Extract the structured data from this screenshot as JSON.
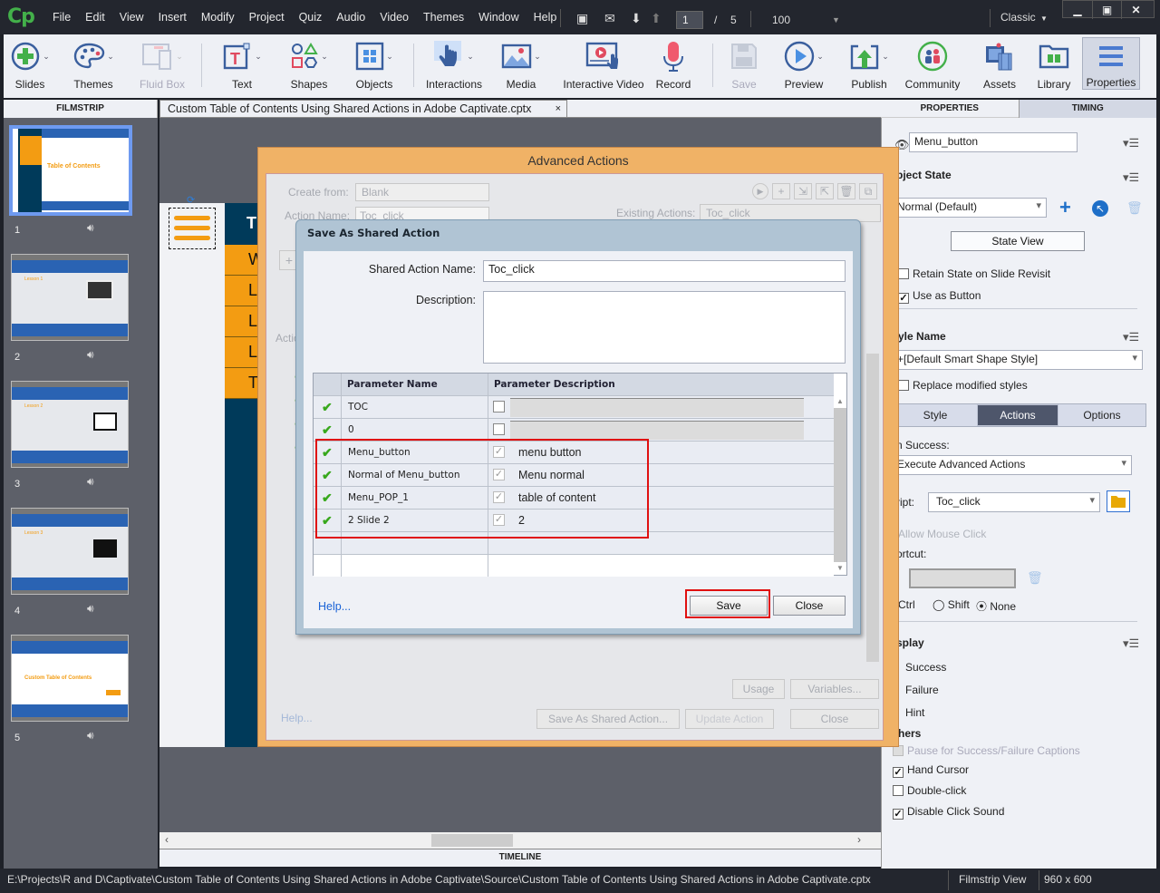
{
  "app": {
    "logo": "Cp",
    "menu": [
      "File",
      "Edit",
      "View",
      "Insert",
      "Modify",
      "Project",
      "Quiz",
      "Audio",
      "Video",
      "Themes",
      "Window",
      "Help"
    ],
    "page_current": "1",
    "page_sep": "/",
    "page_total": "5",
    "zoom": "100",
    "workspace": "Classic",
    "window_controls": [
      "minimize",
      "maximize",
      "close"
    ]
  },
  "toolbar": {
    "items": [
      {
        "label": "Slides",
        "icon": "plus-circle-icon"
      },
      {
        "label": "Themes",
        "icon": "palette-icon"
      },
      {
        "label": "Fluid Box",
        "icon": "fluid-box-icon",
        "disabled": true
      },
      {
        "label": "Text",
        "icon": "text-icon"
      },
      {
        "label": "Shapes",
        "icon": "shapes-icon"
      },
      {
        "label": "Objects",
        "icon": "objects-icon"
      },
      {
        "label": "Interactions",
        "icon": "hand-pointer-icon"
      },
      {
        "label": "Media",
        "icon": "image-icon"
      },
      {
        "label": "Interactive Video",
        "icon": "interactive-video-icon"
      },
      {
        "label": "Record",
        "icon": "microphone-icon"
      },
      {
        "label": "Save",
        "icon": "floppy-icon",
        "disabled": true
      },
      {
        "label": "Preview",
        "icon": "play-icon"
      },
      {
        "label": "Publish",
        "icon": "publish-icon"
      },
      {
        "label": "Community",
        "icon": "community-icon"
      },
      {
        "label": "Assets",
        "icon": "assets-icon"
      },
      {
        "label": "Library",
        "icon": "library-icon"
      },
      {
        "label": "Properties",
        "icon": "properties-icon"
      }
    ]
  },
  "filmstrip": {
    "header": "FILMSTRIP",
    "slides": [
      {
        "num": "1",
        "title": "Table of Contents"
      },
      {
        "num": "2",
        "title": "Lesson 1"
      },
      {
        "num": "3",
        "title": "Lesson 2"
      },
      {
        "num": "4",
        "title": "Lesson 3"
      },
      {
        "num": "5",
        "title": "Custom Table of Contents"
      }
    ]
  },
  "document_tab": {
    "title": "Custom Table of Contents Using Shared Actions in Adobe Captivate.cptx",
    "close": "×"
  },
  "slide_canvas": {
    "title_initial": "T",
    "rows": [
      "W",
      "L",
      "L",
      "L",
      "T"
    ]
  },
  "timeline_label": "TIMELINE",
  "status_bar": {
    "path": "E:\\Projects\\R and D\\Captivate\\Custom Table of Contents Using Shared Actions in Adobe Captivate\\Source\\Custom Table of Contents Using Shared Actions in Adobe Captivate.cptx",
    "view": "Filmstrip View",
    "resolution": "960 x 600"
  },
  "properties": {
    "tabs": [
      "PROPERTIES",
      "TIMING"
    ],
    "object_name": "Menu_button",
    "object_state_label": "bject State",
    "state_value": "Normal (Default)",
    "state_view_button": "State View",
    "retain_state": "Retain State on Slide Revisit",
    "use_as_button": "Use as Button",
    "style_name_label": "yle Name",
    "style_value": "+[Default Smart Shape Style]",
    "replace_styles": "Replace modified styles",
    "subtabs": [
      "Style",
      "Actions",
      "Options"
    ],
    "on_success_label": "n Success:",
    "on_success_value": "Execute Advanced Actions",
    "script_label": "ript:",
    "script_value": "Toc_click",
    "allow_mouse_click": "Allow Mouse Click",
    "shortcut_label": "ortcut:",
    "modifiers": [
      "Ctrl",
      "Shift",
      "None"
    ],
    "modifier_selected": "None",
    "display_label": "splay",
    "display_items": [
      "Success",
      "Failure",
      "Hint"
    ],
    "others_label": "thers",
    "others_items": [
      {
        "label": "Pause for Success/Failure Captions",
        "checked": false,
        "disabled": true
      },
      {
        "label": "Hand Cursor",
        "checked": true
      },
      {
        "label": "Double-click",
        "checked": false
      },
      {
        "label": "Disable Click Sound",
        "checked": true
      }
    ]
  },
  "advanced_actions": {
    "title": "Advanced Actions",
    "create_from_label": "Create from:",
    "create_from_value": "Blank",
    "action_name_label": "Action Name:",
    "action_name_value": "Toc_click",
    "existing_actions_label": "Existing Actions:",
    "existing_actions_value": "Toc_click",
    "usage_button": "Usage",
    "variables_button": "Variables...",
    "help_link": "Help...",
    "save_shared_button": "Save As Shared Action...",
    "update_button": "Update Action",
    "close_button": "Close",
    "partial_col": "Actio",
    "partial_u": "U"
  },
  "shared_action_dialog": {
    "title": "Save As Shared Action",
    "name_label": "Shared Action Name:",
    "name_value": "Toc_click",
    "description_label": "Description:",
    "description_value": "",
    "col_name": "Parameter Name",
    "col_desc": "Parameter Description",
    "parameters": [
      {
        "name": "TOC",
        "checked": false,
        "description": ""
      },
      {
        "name": "0",
        "checked": false,
        "description": ""
      },
      {
        "name": "Menu_button",
        "checked": true,
        "description": "menu button"
      },
      {
        "name": "Normal of Menu_button",
        "checked": true,
        "description": "Menu normal"
      },
      {
        "name": "Menu_POP_1",
        "checked": true,
        "description": "table of content"
      },
      {
        "name": "2 Slide 2",
        "checked": true,
        "description": "2"
      }
    ],
    "help_link": "Help...",
    "save_button": "Save",
    "close_button": "Close",
    "highlight_color": "#e01010"
  }
}
